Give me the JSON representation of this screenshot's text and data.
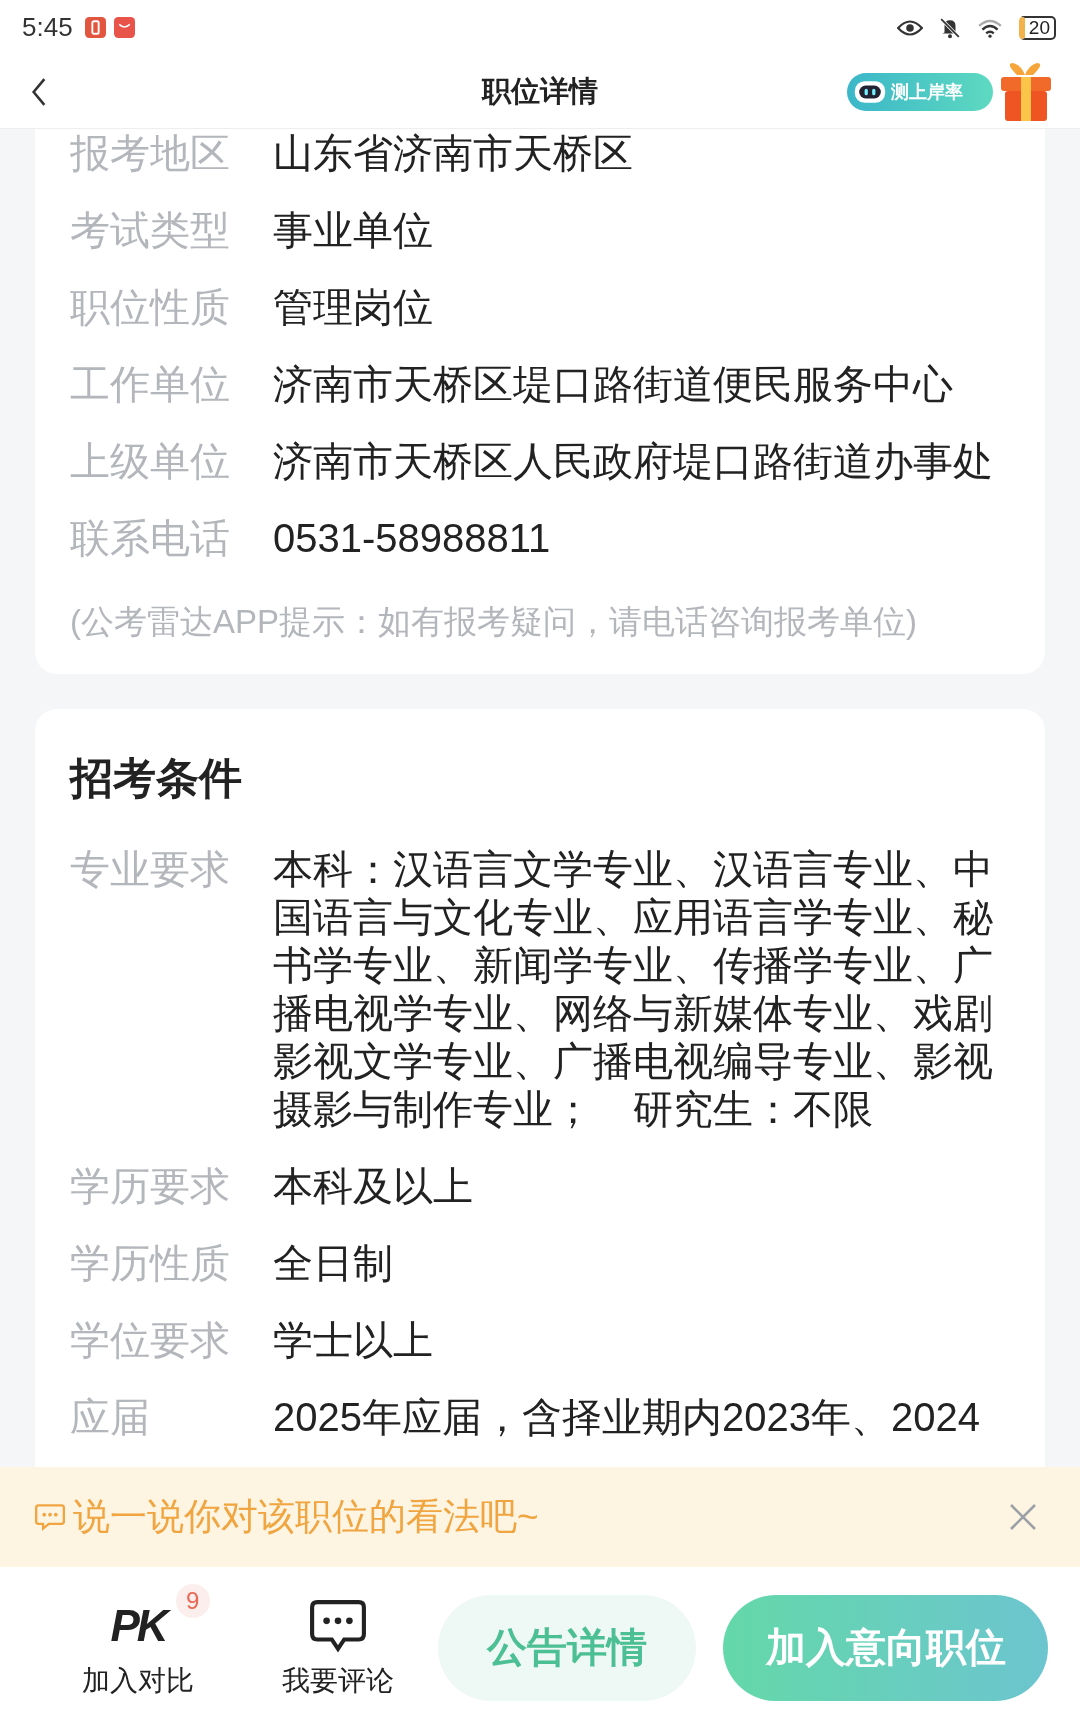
{
  "status_bar": {
    "time": "5:45",
    "battery": "20"
  },
  "header": {
    "title": "职位详情",
    "badge": "测上岸率"
  },
  "info_card": {
    "rows": [
      {
        "label": "报考地区",
        "value": "山东省济南市天桥区"
      },
      {
        "label": "考试类型",
        "value": "事业单位"
      },
      {
        "label": "职位性质",
        "value": "管理岗位"
      },
      {
        "label": "工作单位",
        "value": "济南市天桥区堤口路街道便民服务中心"
      },
      {
        "label": "上级单位",
        "value": "济南市天桥区人民政府堤口路街道办事处"
      },
      {
        "label": "联系电话",
        "value": "0531-58988811"
      }
    ],
    "tip": "(公考雷达APP提示：如有报考疑问，请电话咨询报考单位)"
  },
  "conditions_card": {
    "title": "招考条件",
    "rows": [
      {
        "label": "专业要求",
        "value": "本科：汉语言文学专业、汉语言专业、中国语言与文化专业、应用语言学专业、秘书学专业、新闻学专业、传播学专业、广播电视学专业、网络与新媒体专业、戏剧影视文学专业、广播电视编导专业、影视摄影与制作专业；　研究生：不限"
      },
      {
        "label": "学历要求",
        "value": "本科及以上"
      },
      {
        "label": "学历性质",
        "value": "全日制"
      },
      {
        "label": "学位要求",
        "value": "学士以上"
      },
      {
        "label": "应届",
        "value": "2025年应届，含择业期内2023年、2024"
      }
    ]
  },
  "comment_banner": {
    "text": "说一说你对该职位的看法吧~"
  },
  "bottom_bar": {
    "actions": [
      {
        "kind": "compare",
        "icon_text": "PK",
        "badge": "9",
        "label": "加入对比"
      },
      {
        "kind": "comment",
        "label": "我要评论"
      }
    ],
    "buttons": [
      {
        "kind": "secondary",
        "label": "公告详情"
      },
      {
        "kind": "primary",
        "label": "加入意向职位"
      }
    ]
  }
}
